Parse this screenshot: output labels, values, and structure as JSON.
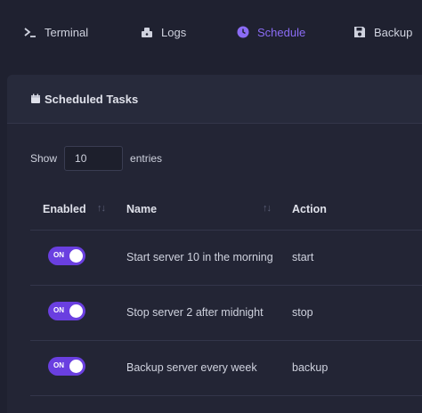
{
  "nav": {
    "items": [
      {
        "label": "Terminal",
        "icon": "terminal-icon",
        "active": false
      },
      {
        "label": "Logs",
        "icon": "logs-icon",
        "active": false
      },
      {
        "label": "Schedule",
        "icon": "clock-icon",
        "active": true
      },
      {
        "label": "Backup",
        "icon": "floppy-icon",
        "active": false
      }
    ]
  },
  "colors": {
    "background": "#1f2130",
    "card": "#232535",
    "accent": "#8b6cf5",
    "toggle_on": "#6a3fe0"
  },
  "card": {
    "title": "Scheduled Tasks",
    "icon": "calendar-icon"
  },
  "length": {
    "show_label": "Show",
    "value": "10",
    "entries_label": "entries"
  },
  "table": {
    "headers": {
      "enabled": "Enabled",
      "name": "Name",
      "action": "Action"
    },
    "rows": [
      {
        "toggle_label": "ON",
        "name": "Start server 10 in the morning",
        "action": "start"
      },
      {
        "toggle_label": "ON",
        "name": "Stop server 2 after midnight",
        "action": "stop"
      },
      {
        "toggle_label": "ON",
        "name": "Backup server every week",
        "action": "backup"
      }
    ]
  }
}
